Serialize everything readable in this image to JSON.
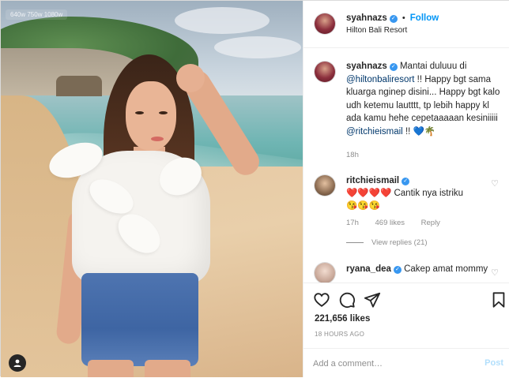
{
  "photo": {
    "watermark": "640w  750w  1080w"
  },
  "header": {
    "username": "syahnazs",
    "separator": "•",
    "follow_label": "Follow",
    "location": "Hilton Bali Resort"
  },
  "caption": {
    "username": "syahnazs",
    "text_1": " Mantai duluuu di ",
    "mention_1": "@hiltonbaliresort",
    "text_2": " !! Happy bgt sama kluarga nginep disini... Happy bgt kalo udh ketemu lautttt, tp lebih happy kl ada kamu hehe cepetaaaaan kesiniiiii ",
    "mention_2": "@ritchieismail",
    "text_3": " !! 💙🌴",
    "time": "18h"
  },
  "comments": [
    {
      "username": "ritchieismail",
      "text_1": " ❤️❤️❤️❤️ Cantik nya istriku",
      "text_2": "😘😘😘",
      "time": "17h",
      "likes": "469 likes",
      "reply_label": "Reply",
      "view_replies": "View replies (21)"
    },
    {
      "username": "ryana_dea",
      "text": " Cakep amat mommy"
    }
  ],
  "actions": {
    "likes": "221,656 likes",
    "posted_ago": "18 HOURS AGO",
    "comment_placeholder": "Add a comment…",
    "post_label": "Post"
  }
}
